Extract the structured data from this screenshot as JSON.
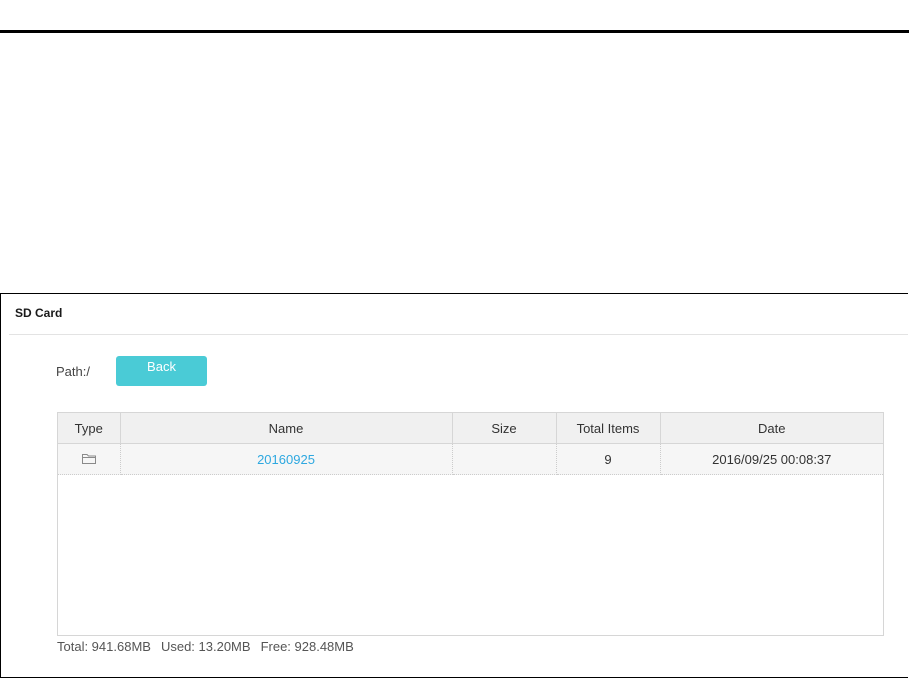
{
  "panel": {
    "title": "SD Card",
    "path_label": "Path:/",
    "back_label": "Back"
  },
  "table": {
    "columns": [
      "Type",
      "Name",
      "Size",
      "Total Items",
      "Date"
    ],
    "rows": [
      {
        "type_icon": "folder-icon",
        "name": "20160925",
        "size": "",
        "total_items": "9",
        "date": "2016/09/25 00:08:37"
      }
    ]
  },
  "storage": {
    "total": "Total: 941.68MB",
    "used": "Used: 13.20MB",
    "free": "Free: 928.48MB"
  },
  "colors": {
    "accent_button": "#4acbd6",
    "link": "#2ea8e0"
  }
}
